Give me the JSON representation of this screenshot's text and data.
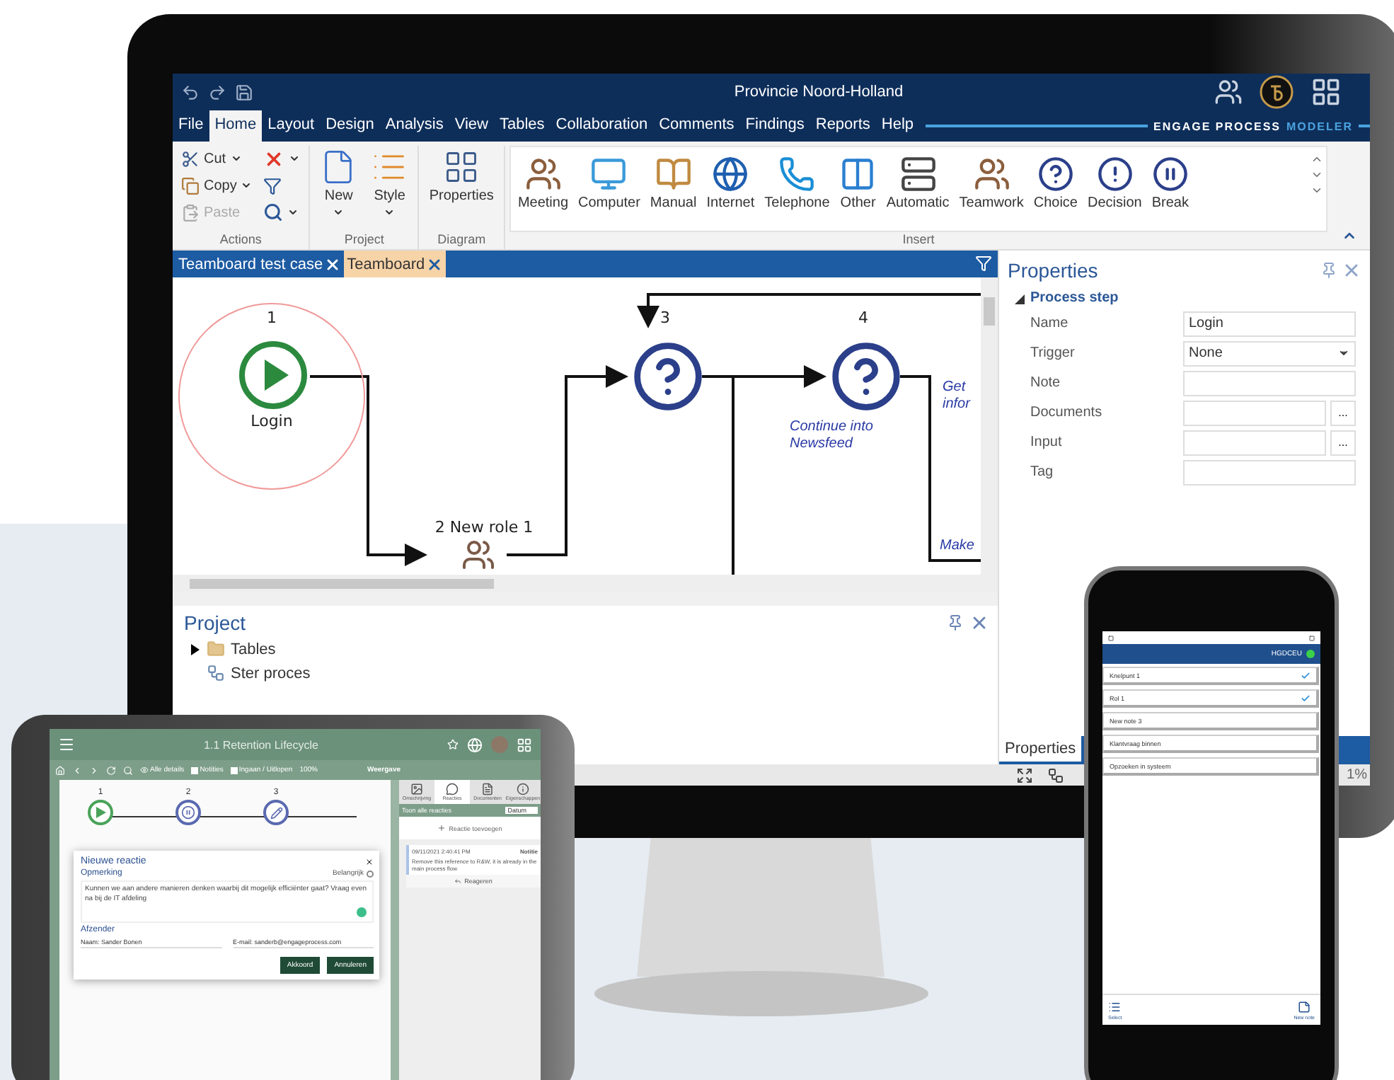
{
  "monitor": {
    "title": "Provincie Noord-Holland",
    "brand": {
      "word_1": "ENGAGE PROCESS",
      "word_2": "MODELER"
    },
    "menu": [
      {
        "label": "File",
        "selected": false
      },
      {
        "label": "Home",
        "selected": true
      },
      {
        "label": "Layout",
        "selected": false
      },
      {
        "label": "Design",
        "selected": false
      },
      {
        "label": "Analysis",
        "selected": false
      },
      {
        "label": "View",
        "selected": false
      },
      {
        "label": "Tables",
        "selected": false
      },
      {
        "label": "Collaboration",
        "selected": false
      },
      {
        "label": "Comments",
        "selected": false
      },
      {
        "label": "Findings",
        "selected": false
      },
      {
        "label": "Reports",
        "selected": false
      },
      {
        "label": "Help",
        "selected": false
      }
    ],
    "ribbon": {
      "actions": {
        "title": "Actions",
        "items": [
          {
            "label": "Cut",
            "kind": "cut",
            "disabled": false
          },
          {
            "label": "Copy",
            "kind": "copy",
            "disabled": false
          },
          {
            "label": "Paste",
            "kind": "paste",
            "disabled": true
          }
        ]
      },
      "project": {
        "title": "Project",
        "items": [
          {
            "label": "New",
            "kind": "new"
          },
          {
            "label": "Style",
            "kind": "style"
          }
        ]
      },
      "diagram": {
        "title": "Diagram",
        "items": [
          {
            "label": "Properties",
            "kind": "table"
          }
        ]
      },
      "insert": {
        "title": "Insert",
        "items": [
          {
            "label": "Meeting",
            "kind": "people"
          },
          {
            "label": "Computer",
            "kind": "computer"
          },
          {
            "label": "Manual",
            "kind": "manual"
          },
          {
            "label": "Internet",
            "kind": "globe"
          },
          {
            "label": "Telephone",
            "kind": "phone"
          },
          {
            "label": "Other",
            "kind": "other"
          },
          {
            "label": "Automatic",
            "kind": "server"
          },
          {
            "label": "Teamwork",
            "kind": "people"
          },
          {
            "label": "Choice",
            "kind": "question"
          },
          {
            "label": "Decision",
            "kind": "alert"
          },
          {
            "label": "Break",
            "kind": "pause"
          }
        ]
      }
    },
    "doc_tabs": [
      {
        "label": "Teamboard test case",
        "selected": false
      },
      {
        "label": "Teamboard",
        "selected": true
      }
    ],
    "diagram": {
      "nodes": [
        {
          "kind": "start",
          "number": "1",
          "label": "Login",
          "highlighted": true
        },
        {
          "kind": "role",
          "number": "2 New role 1"
        },
        {
          "kind": "question",
          "number": "3"
        },
        {
          "kind": "question",
          "number": "4",
          "note": "Continue into Newsfeed"
        }
      ],
      "side_notes": [
        "Get infor",
        "Make"
      ]
    },
    "project_panel": {
      "title": "Project",
      "items": [
        {
          "label": "Tables",
          "kind": "folder",
          "expanded": false
        },
        {
          "label": "Ster proces",
          "kind": "diagram"
        }
      ]
    },
    "properties": {
      "title": "Properties",
      "section": "Process step",
      "expanded": true,
      "fields": [
        {
          "label": "Name",
          "kind": "text",
          "value": "Login"
        },
        {
          "label": "Trigger",
          "kind": "select",
          "value": "None"
        },
        {
          "label": "Note",
          "kind": "text"
        },
        {
          "label": "Documents",
          "kind": "browse",
          "button": "..."
        },
        {
          "label": "Input",
          "kind": "browse",
          "button": "..."
        },
        {
          "label": "Tag",
          "kind": "text"
        }
      ]
    },
    "bottom_tab": "Properties",
    "zoom": "1%"
  },
  "tablet": {
    "title": "1.1 Retention Lifecycle",
    "toolbar": {
      "details": "Alle details",
      "checks": [
        {
          "label": "Notities",
          "checked": false
        },
        {
          "label": "Ingaan / Uitlopen",
          "checked": false
        }
      ],
      "zoom": "100%",
      "view": "Weergave"
    },
    "steps": [
      {
        "number": "1",
        "kind": "play"
      },
      {
        "number": "2",
        "kind": "pause"
      },
      {
        "number": "3",
        "kind": "pencil"
      }
    ],
    "dialog": {
      "title": "Nieuwe reactie",
      "remark_label": "Opmerking",
      "important_label": "Belangrijk",
      "important": false,
      "text": "Kunnen we aan andere manieren denken waarbij dit mogelijk efficiënter gaat? Vraag even na bij de IT afdeling",
      "sender_label": "Afzender",
      "name": "Naam: Sander Bonen",
      "email": "E-mail: sanderb@engageprocess.com",
      "buttons": [
        "Akkoord",
        "Annuleren"
      ]
    },
    "side_tabs": [
      {
        "label": "Omschrijving",
        "kind": "image",
        "selected": false
      },
      {
        "label": "Reacties",
        "kind": "chat",
        "selected": true
      },
      {
        "label": "Documenten",
        "kind": "doc",
        "selected": false
      },
      {
        "label": "Eigenschappen",
        "kind": "info",
        "selected": false
      }
    ],
    "show_all": "Toon alle reacties",
    "sort": "Datum",
    "add": "Reactie toevoegen",
    "comment": {
      "date": "09/11/2021 2:40:41 PM",
      "tag": "Notitie",
      "text": "Remove this reference to R&W, it is already in the main process flow"
    },
    "reply": "Reageren"
  },
  "phone": {
    "header": "HGDCEU",
    "items": [
      {
        "label": "Knelpunt 1",
        "checked": true
      },
      {
        "label": "Rol 1",
        "checked": true
      },
      {
        "label": "New note 3",
        "checked": false
      },
      {
        "label": "Klantvraag binnen",
        "checked": false
      },
      {
        "label": "Opzoeken in systeem",
        "checked": false
      }
    ],
    "actions": [
      "Select",
      "New note"
    ]
  }
}
